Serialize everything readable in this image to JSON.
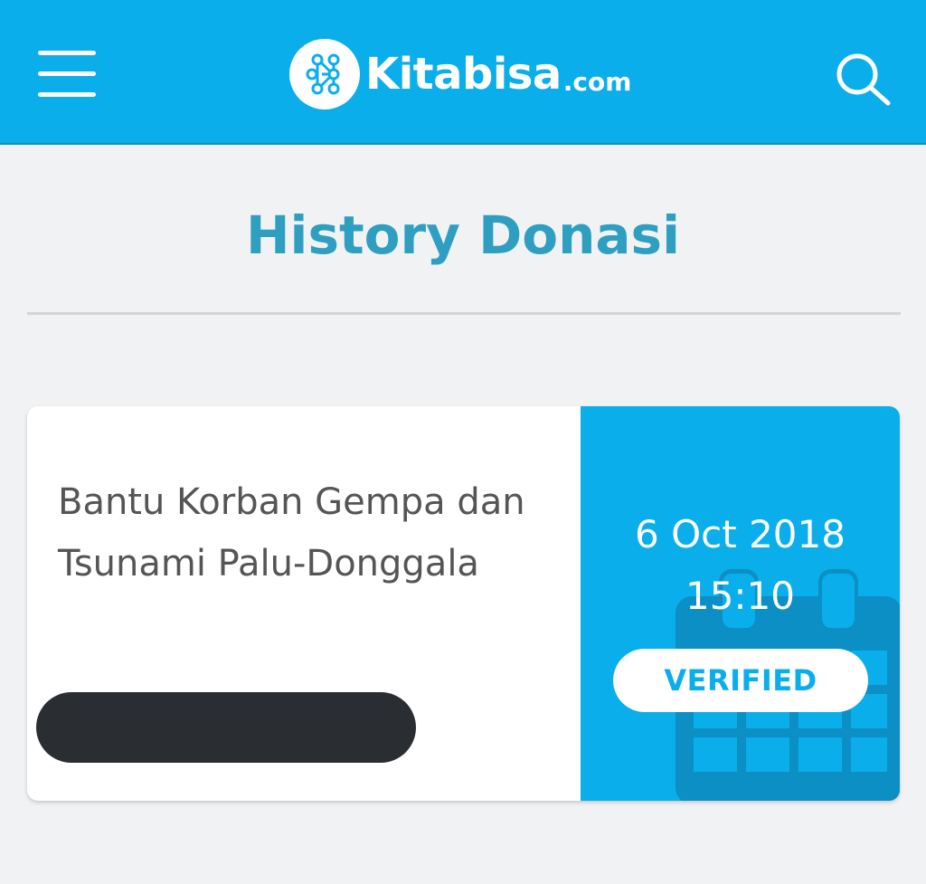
{
  "header": {
    "brand_name": "Kitabisa",
    "brand_suffix": ".com",
    "menu_icon": "hamburger-menu-icon",
    "search_icon": "search-icon",
    "color": "#0aaeeb"
  },
  "page": {
    "title": "History Donasi"
  },
  "donations": [
    {
      "campaign_title": "Bantu Korban Gempa dan Tsunami Palu-Donggala",
      "date": "6 Oct 2018",
      "time": "15:10",
      "status": "VERIFIED",
      "amount_redacted": true
    }
  ],
  "colors": {
    "accent": "#0aaeeb",
    "title": "#2f9fc1",
    "background": "#f1f2f4"
  }
}
